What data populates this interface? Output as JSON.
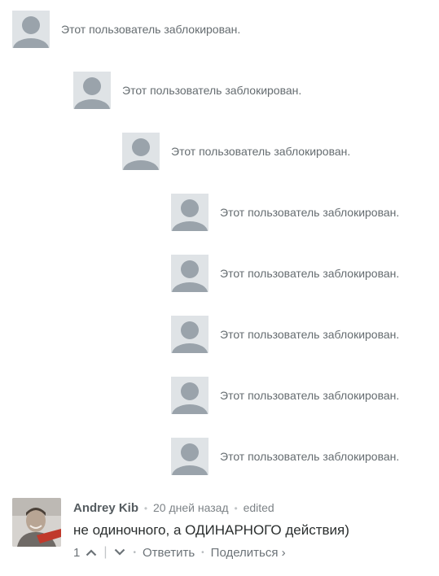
{
  "blocked_comments": [
    {
      "text": "Этот пользователь заблокирован."
    },
    {
      "text": "Этот пользователь заблокирован."
    },
    {
      "text": "Этот пользователь заблокирован."
    },
    {
      "text": "Этот пользователь заблокирован."
    },
    {
      "text": "Этот пользователь заблокирован."
    },
    {
      "text": "Этот пользователь заблокирован."
    },
    {
      "text": "Этот пользователь заблокирован."
    },
    {
      "text": "Этот пользователь заблокирован."
    }
  ],
  "comment": {
    "author": "Andrey Kib",
    "time": "20 дней назад",
    "edited": "edited",
    "message": "не одиночного, а ОДИНАРНОГО действия)",
    "votes": "1",
    "reply_label": "Ответить",
    "share_label": "Поделиться ›"
  },
  "colors": {
    "placeholder_bg": "#dfe3e6",
    "placeholder_figure": "#9aa3ab",
    "text_muted": "#656c70"
  }
}
